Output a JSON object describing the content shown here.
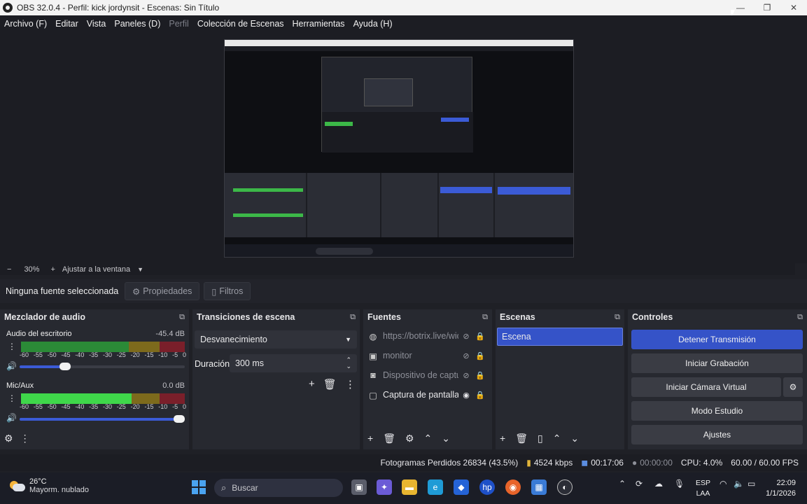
{
  "window": {
    "title": "OBS 32.0.4 - Perfil: kick jordynsit - Escenas: Sin Título",
    "minimize": "—",
    "maximize": "❐",
    "close": "✕"
  },
  "menu": [
    "Archivo (F)",
    "Editar",
    "Vista",
    "Paneles (D)",
    "Perfil",
    "Colección de Escenas",
    "Herramientas",
    "Ayuda (H)"
  ],
  "zoom": {
    "minus": "−",
    "value": "30%",
    "plus": "+",
    "fit": "Ajustar a la ventana",
    "dropdown": "▼"
  },
  "source_bar": {
    "no_source": "Ninguna fuente seleccionada",
    "properties": "Propiedades",
    "filters": "Filtros"
  },
  "mixer": {
    "title": "Mezclador de audio",
    "scale": [
      "-60",
      "-55",
      "-50",
      "-45",
      "-40",
      "-35",
      "-30",
      "-25",
      "-20",
      "-15",
      "-10",
      "-5",
      "0"
    ],
    "channels": [
      {
        "name": "Audio del escritorio",
        "db": "-45.4 dB",
        "volume_level": 0.26
      },
      {
        "name": "Mic/Aux",
        "db": "0.0 dB",
        "volume_level": 1.0
      }
    ]
  },
  "transitions": {
    "title": "Transiciones de escena",
    "selected": "Desvanecimiento",
    "duration_label": "Duración",
    "duration_value": "300 ms"
  },
  "sources": {
    "title": "Fuentes",
    "items": [
      {
        "name": "https://botrix.live/widgets",
        "icon": "globe-icon",
        "visible": false
      },
      {
        "name": "monitor",
        "icon": "monitor-icon",
        "visible": false
      },
      {
        "name": "Dispositivo de captura",
        "icon": "camera-icon",
        "visible": false
      },
      {
        "name": "Captura de pantalla",
        "icon": "screen-icon",
        "visible": true
      }
    ]
  },
  "scenes": {
    "title": "Escenas",
    "items": [
      "Escena"
    ]
  },
  "controls": {
    "title": "Controles",
    "stop_stream": "Detener Transmisión",
    "start_record": "Iniciar Grabación",
    "virtual_cam": "Iniciar Cámara Virtual",
    "studio_mode": "Modo Estudio",
    "settings": "Ajustes"
  },
  "status": {
    "dropped": "Fotogramas Perdidos 26834 (43.5%)",
    "bitrate": "4524 kbps",
    "stream_time": "00:17:06",
    "rec_time": "00:00:00",
    "cpu": "CPU: 4.0%",
    "fps": "60.00 / 60.00 FPS"
  },
  "taskbar": {
    "weather_temp": "26°C",
    "weather_desc": "Mayorm. nublado",
    "search_placeholder": "Buscar",
    "lang_top": "ESP",
    "lang_bottom": "LAA",
    "time": "22:09",
    "date": "1/1/2026"
  },
  "colors": {
    "accent": "#3553c8",
    "meter_green": "#3fd74a",
    "meter_yellow": "#7d6a1c",
    "meter_red": "#7a1f2a"
  }
}
